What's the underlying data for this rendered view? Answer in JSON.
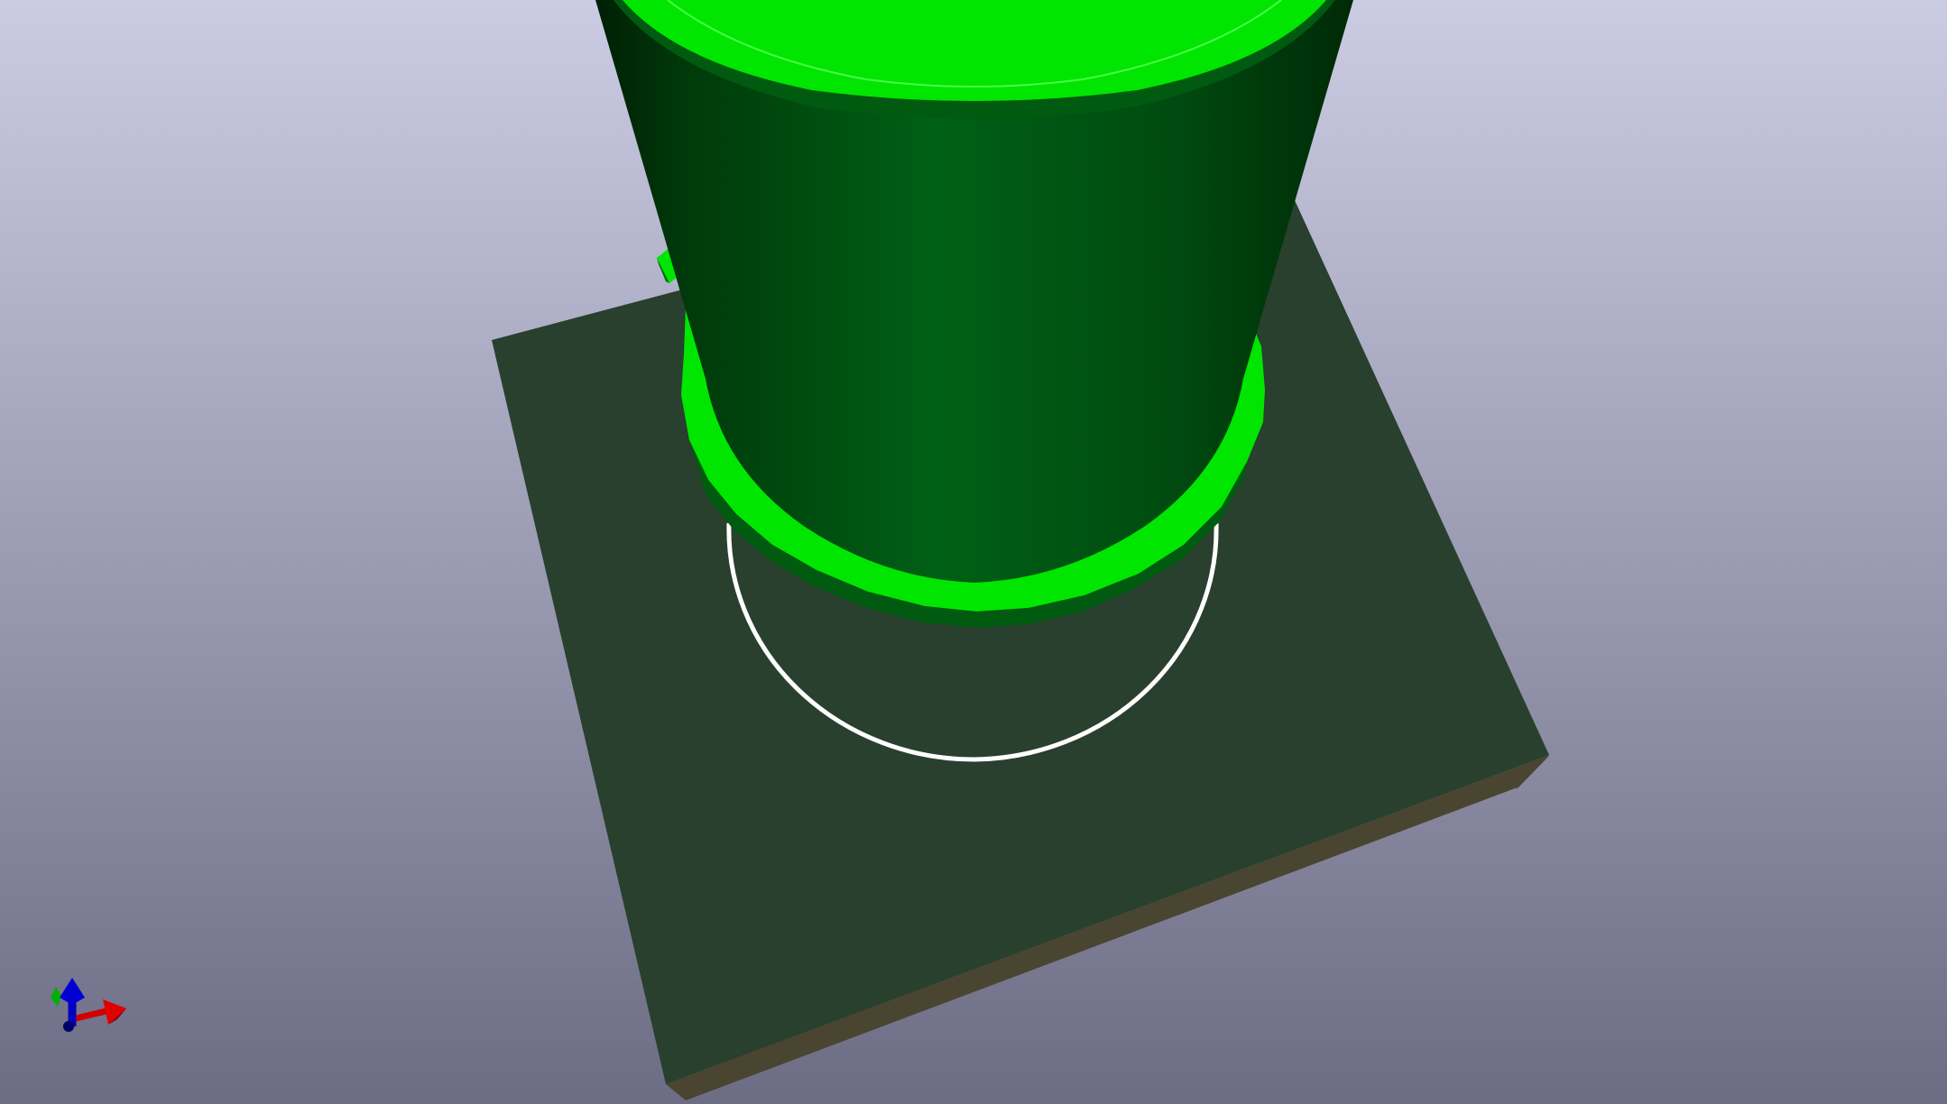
{
  "viewer": {
    "background_top": "#cbcce4",
    "background_bottom": "#6c6c84",
    "board_color": "#28402d",
    "board_edge_color": "#4a4530",
    "component_color": "#00e600",
    "component_body_dark": "#003a0a",
    "component_body_mid": "#006b14",
    "outline_color": "#ffffff"
  },
  "axis_gizmo": {
    "x_axis_color": "#e00000",
    "y_axis_color": "#00b000",
    "z_axis_color": "#0000d0"
  },
  "icons": [
    "axis-triad-icon"
  ]
}
